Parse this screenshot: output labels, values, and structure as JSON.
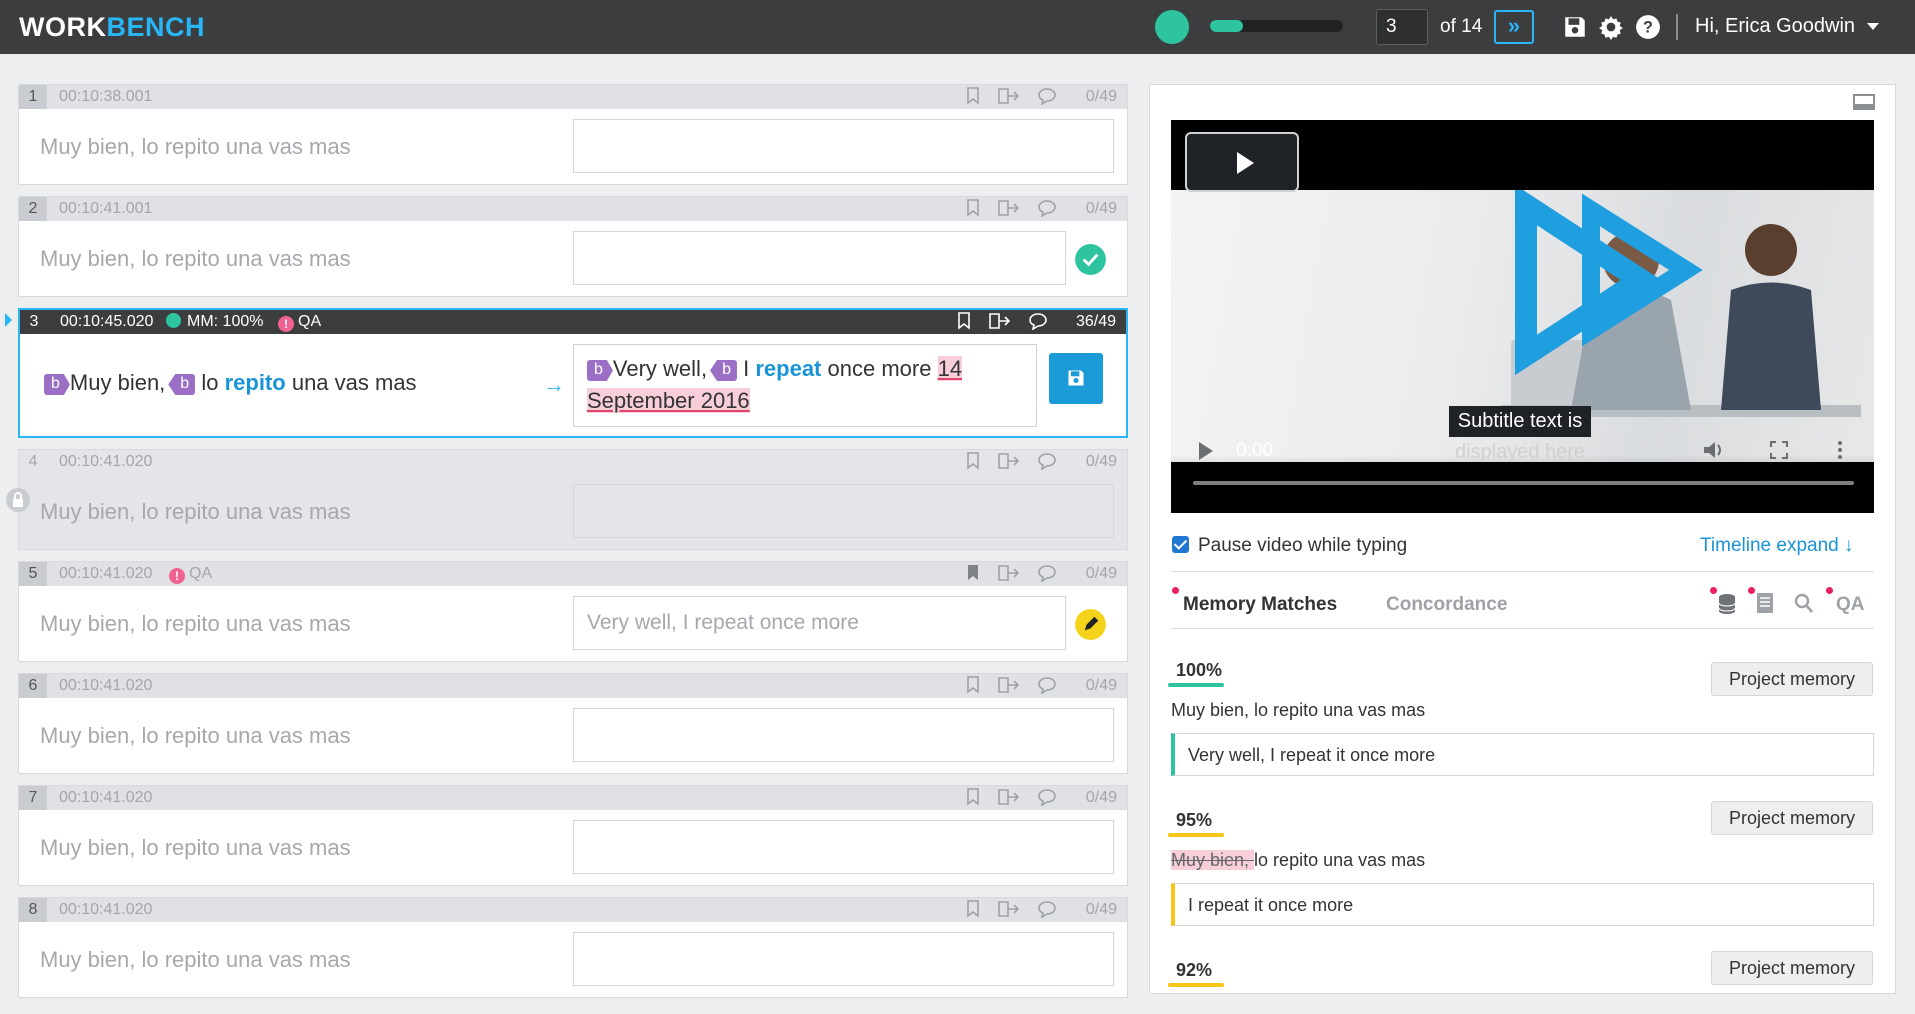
{
  "app": {
    "brand_part1": "WORK",
    "brand_part2": "BENCH"
  },
  "topbar": {
    "progress": 0.25,
    "page_current": "3",
    "page_of": "of 14",
    "jump_label": "»",
    "greeting": "Hi, Erica Goodwin",
    "colors": {
      "accent": "#29b6f6",
      "status": "#2ec4a0"
    }
  },
  "segments": [
    {
      "num": "1",
      "time": "00:10:38.001",
      "source": "Muy bien, lo repito una vas mas",
      "target": "",
      "count": "0/49"
    },
    {
      "num": "2",
      "time": "00:10:41.001",
      "source": "Muy bien, lo repito una vas mas",
      "target": "",
      "count": "0/49",
      "status": "confirmed"
    },
    {
      "num": "3",
      "time": "00:10:45.020",
      "mm": "MM: 100%",
      "qa": "QA",
      "count": "36/49",
      "source_parts": {
        "tag1": "b",
        "text1": "Muy bien,",
        "tag2": "b",
        "text2": "lo",
        "kw": "repito",
        "text3": "una vas mas"
      },
      "target_parts": {
        "tag1": "b",
        "text1": "Very well,",
        "tag2": "b",
        "text2": "I",
        "kw": "repeat",
        "text3": "once more",
        "date1": "14",
        "date2": "September 2016"
      }
    },
    {
      "num": "4",
      "time": "00:10:41.020",
      "source": "Muy bien, lo repito una vas mas",
      "target": "",
      "count": "0/49",
      "locked": true
    },
    {
      "num": "5",
      "time": "00:10:41.020",
      "qa": "QA",
      "source": "Muy bien, lo repito una vas mas",
      "target": "Very well, I repeat once more",
      "count": "0/49",
      "status": "edit"
    },
    {
      "num": "6",
      "time": "00:10:41.020",
      "source": "Muy bien, lo repito una vas mas",
      "target": "",
      "count": "0/49"
    },
    {
      "num": "7",
      "time": "00:10:41.020",
      "source": "Muy bien, lo repito una vas mas",
      "target": "",
      "count": "0/49"
    },
    {
      "num": "8",
      "time": "00:10:41.020",
      "source": "Muy bien, lo repito una vas mas",
      "target": "",
      "count": "0/49"
    }
  ],
  "video": {
    "time": "0:00",
    "subtitle_line1": "Subtitle text is",
    "subtitle_line2": "displayed here"
  },
  "panel": {
    "pause_label": "Pause video while typing",
    "pause_checked": true,
    "timeline_label": "Timeline expand",
    "tab_memory": "Memory Matches",
    "tab_concordance": "Concordance",
    "tab_qa": "QA"
  },
  "matches": [
    {
      "pct": "100%",
      "bar_color": "#2ec4a0",
      "button": "Project memory",
      "source": "Muy bien, lo repito una vas mas",
      "target": "Very well, I repeat it once more"
    },
    {
      "pct": "95%",
      "bar_color": "#f5c518",
      "button": "Project memory",
      "source_removed": "Muy bien, ",
      "source_rest": "lo repito una vas mas",
      "target": "I repeat it once more"
    },
    {
      "pct": "92%",
      "bar_color": "#f5c518",
      "button": "Project memory"
    }
  ]
}
